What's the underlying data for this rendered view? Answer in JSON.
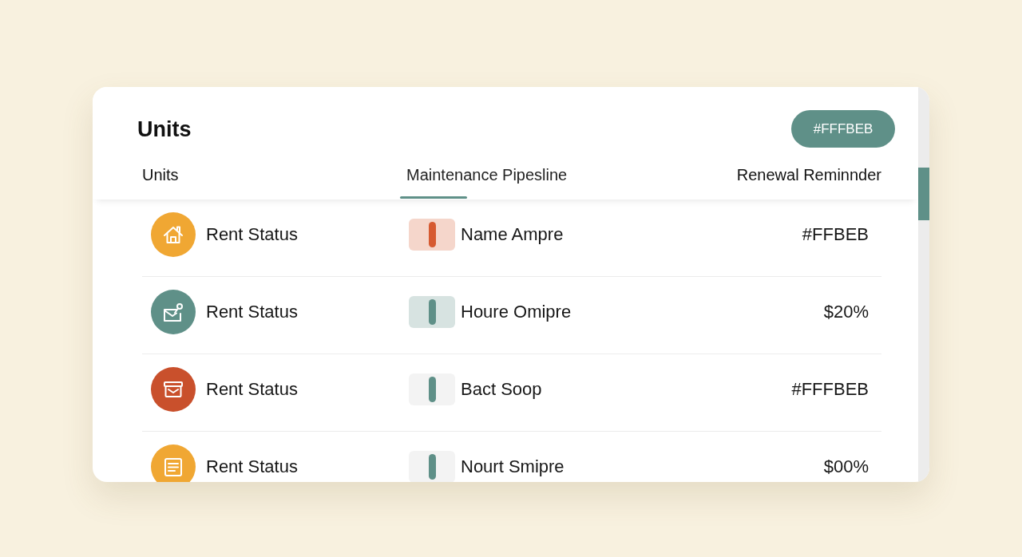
{
  "header": {
    "title": "Units",
    "button": {
      "label": "#FFFBEB"
    }
  },
  "tabs": [
    {
      "label": "Units",
      "selected": false
    },
    {
      "label": "Maintenance Pipesline",
      "selected": true
    },
    {
      "label": "Renewal Reminnder",
      "selected": false
    }
  ],
  "rows": [
    {
      "icon": {
        "kind": "house",
        "color": "#f0a733"
      },
      "label": "Rent Status",
      "indicator": {
        "color": "#d65a31",
        "tinted": true
      },
      "detail": "Name Ampre",
      "value": "#FFBEB"
    },
    {
      "icon": {
        "kind": "mail-pin",
        "color": "#5f9088"
      },
      "label": "Rent Status",
      "indicator": {
        "color": "#5f9088",
        "tinted": true
      },
      "detail": "Houre Omipre",
      "value": "$20%"
    },
    {
      "icon": {
        "kind": "mail-box",
        "color": "#c9502c"
      },
      "label": "Rent Status",
      "indicator": {
        "color": "#5f9088",
        "tinted": false
      },
      "detail": "Bact Soop",
      "value": "#FFFBEB"
    },
    {
      "icon": {
        "kind": "document",
        "color": "#f0a733"
      },
      "label": "Rent Status",
      "indicator": {
        "color": "#5f9088",
        "tinted": false
      },
      "detail": "Nourt Smipre",
      "value": "$00%"
    }
  ]
}
